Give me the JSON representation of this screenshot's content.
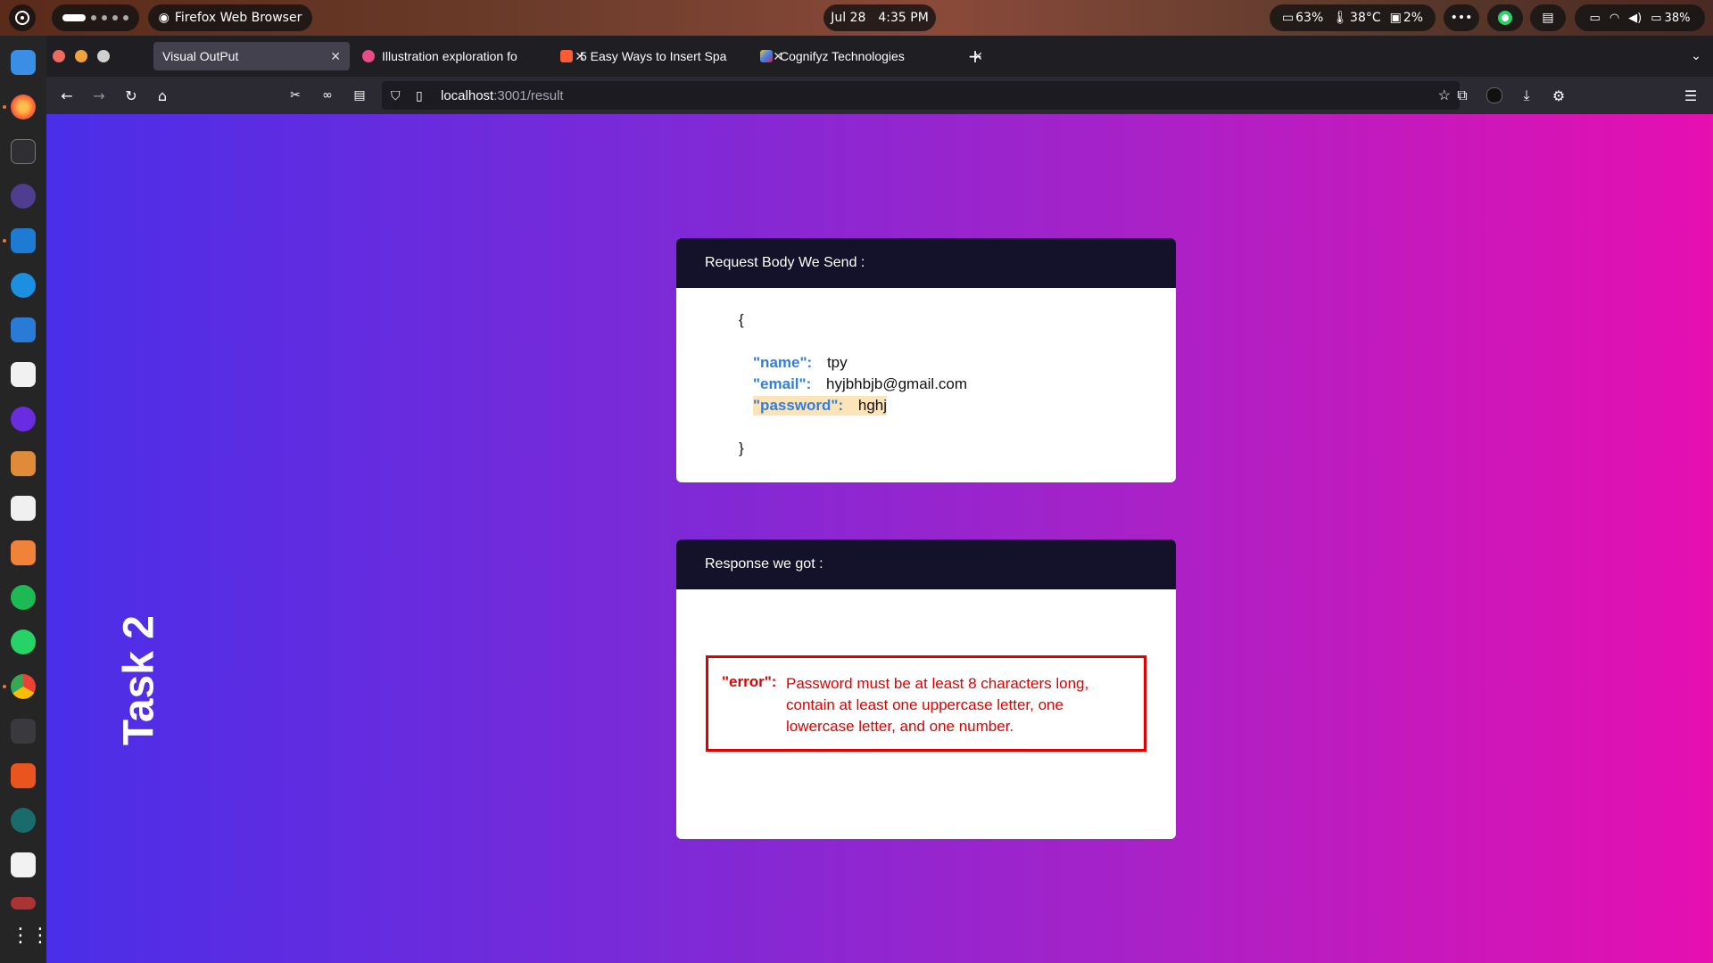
{
  "topbar": {
    "app_name": "Firefox Web Browser",
    "date": "Jul 28",
    "time": "4:35 PM",
    "cpu": "63%",
    "temp": "38°C",
    "disk": "2%",
    "more": "•••",
    "battery": "38%"
  },
  "tabs": [
    {
      "label": "Visual OutPut",
      "active": true
    },
    {
      "label": "Illustration exploration fo",
      "active": false
    },
    {
      "label": "5 Easy Ways to Insert Spa",
      "active": false
    },
    {
      "label": "Cognifyz Technologies",
      "active": false
    }
  ],
  "nav": {
    "url_host": "localhost",
    "url_rest": ":3001/result"
  },
  "page": {
    "side_title": "Task 2",
    "request_card": {
      "title": "Request Body We Send :",
      "open_brace": "{",
      "close_brace": "}",
      "fields": [
        {
          "key": "\"name\":",
          "value": "tpy"
        },
        {
          "key": "\"email\":",
          "value": "hyjbhbjb@gmail.com"
        },
        {
          "key": "\"password\":",
          "value": "hghj"
        }
      ]
    },
    "response_card": {
      "title": "Response we got :",
      "error_key": "\"error\":",
      "error_line1": "Password must be at least 8 characters long,",
      "error_line2": "contain at least one uppercase letter, one",
      "error_line3": "lowercase letter, and one number."
    }
  },
  "colors": {
    "gradient_start": "#4a2ee8",
    "gradient_end": "#e60fb0",
    "card_header": "#14122b",
    "json_key": "#2f7fe0",
    "error": "#e00000",
    "highlight": "#fde3b8"
  }
}
